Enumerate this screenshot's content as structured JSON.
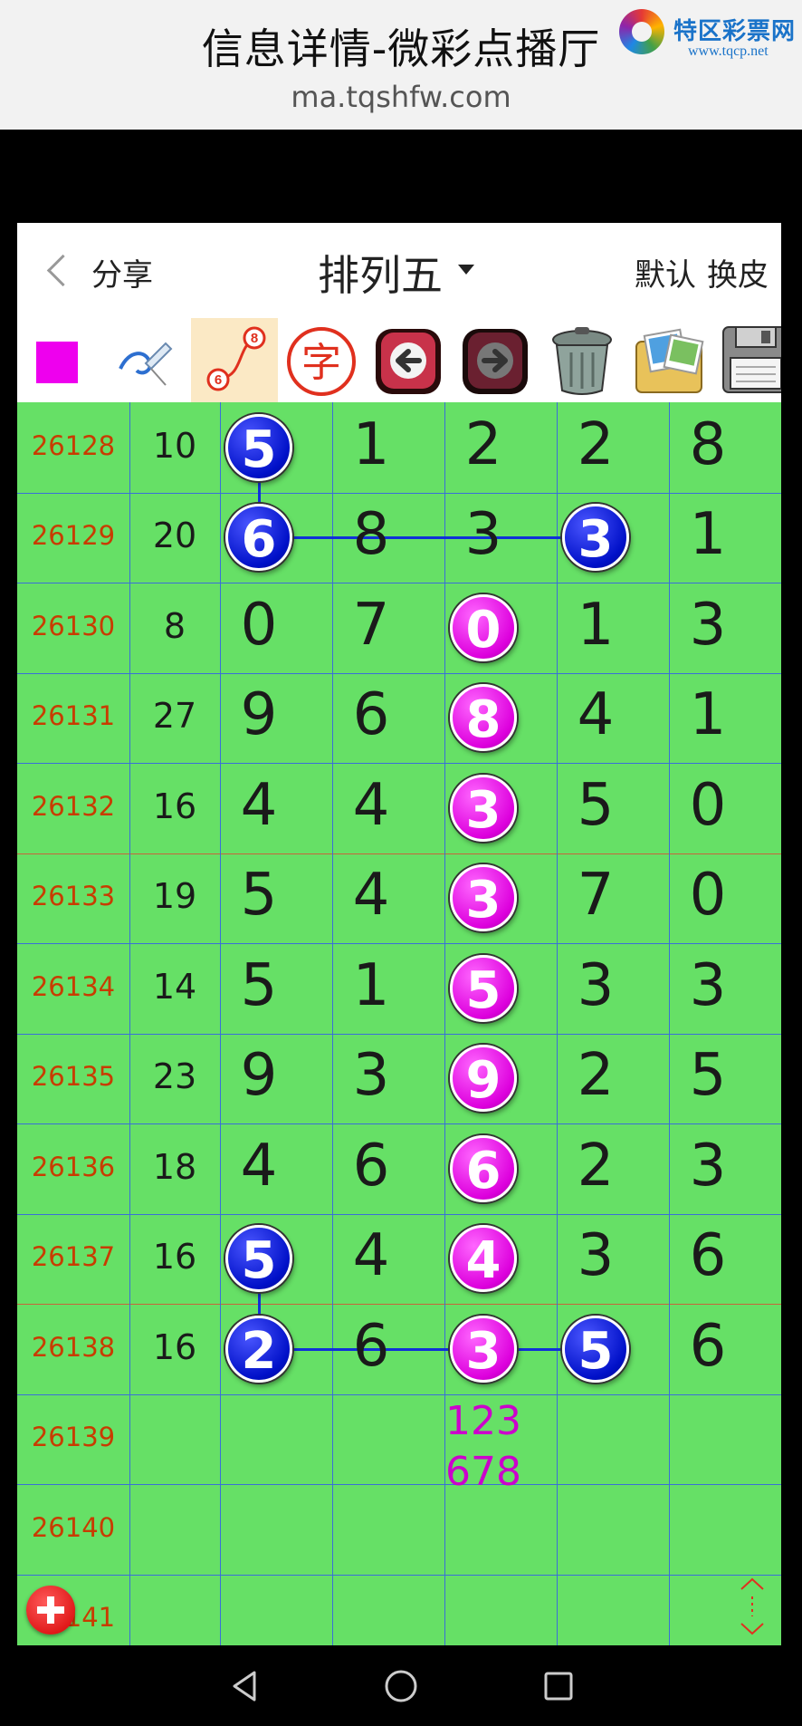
{
  "infobar": {
    "title": "信息详情-微彩点播厅",
    "url": "ma.tqshfw.com",
    "logo_name": "特区彩票网",
    "logo_site": "www.tqcp.net"
  },
  "header": {
    "back_icon": "chevron-left-icon",
    "share_label": "分享",
    "title": "排列五",
    "default_label": "默认",
    "skin_label": "换皮"
  },
  "toolbar": {
    "tools": [
      {
        "name": "color-square",
        "color": "#ee00ee"
      },
      {
        "name": "pen-icon"
      },
      {
        "name": "connect-dots-icon",
        "labels": [
          "8",
          "6"
        ]
      },
      {
        "name": "text-icon",
        "label": "字"
      },
      {
        "name": "undo-arrow-icon"
      },
      {
        "name": "redo-arrow-icon"
      },
      {
        "name": "trash-icon"
      },
      {
        "name": "gallery-icon"
      },
      {
        "name": "save-disk-icon"
      }
    ]
  },
  "grid": {
    "rows": [
      {
        "period": "26128",
        "sum": "10",
        "digits": [
          "5",
          "1",
          "2",
          "2",
          "8"
        ]
      },
      {
        "period": "26129",
        "sum": "20",
        "digits": [
          "6",
          "8",
          "3",
          "3",
          "1"
        ]
      },
      {
        "period": "26130",
        "sum": "8",
        "digits": [
          "0",
          "7",
          "0",
          "1",
          "3"
        ]
      },
      {
        "period": "26131",
        "sum": "27",
        "digits": [
          "9",
          "6",
          "8",
          "4",
          "1"
        ]
      },
      {
        "period": "26132",
        "sum": "16",
        "digits": [
          "4",
          "4",
          "3",
          "5",
          "0"
        ]
      },
      {
        "period": "26133",
        "sum": "19",
        "digits": [
          "5",
          "4",
          "3",
          "7",
          "0"
        ]
      },
      {
        "period": "26134",
        "sum": "14",
        "digits": [
          "5",
          "1",
          "5",
          "3",
          "3"
        ]
      },
      {
        "period": "26135",
        "sum": "23",
        "digits": [
          "9",
          "3",
          "9",
          "2",
          "5"
        ]
      },
      {
        "period": "26136",
        "sum": "18",
        "digits": [
          "4",
          "6",
          "6",
          "2",
          "3"
        ]
      },
      {
        "period": "26137",
        "sum": "16",
        "digits": [
          "5",
          "4",
          "4",
          "3",
          "6"
        ]
      },
      {
        "period": "26138",
        "sum": "16",
        "digits": [
          "2",
          "6",
          "3",
          "5",
          "6"
        ]
      },
      {
        "period": "26139",
        "sum": "",
        "digits": [
          "",
          "",
          "",
          "",
          ""
        ]
      },
      {
        "period": "26140",
        "sum": "",
        "digits": [
          "",
          "",
          "",
          "",
          ""
        ]
      },
      {
        "period": "26141",
        "sum": "",
        "digits": [
          "",
          "",
          "",
          "",
          ""
        ]
      }
    ],
    "prediction": [
      "123",
      "678"
    ],
    "colors": {
      "bg": "#66e066",
      "blue_ball": "#0010c8",
      "magenta_ball": "#dd00dd",
      "period_text": "#c83c00",
      "grid_red": "#c8643c",
      "grid_blue": "#3a6fd8"
    }
  },
  "fab": {
    "add_icon": "plus-circle-icon",
    "resize_icon": "resize-vertical-icon"
  },
  "nav": {
    "back": "nav-back-icon",
    "home": "nav-home-icon",
    "recents": "nav-recents-icon"
  }
}
